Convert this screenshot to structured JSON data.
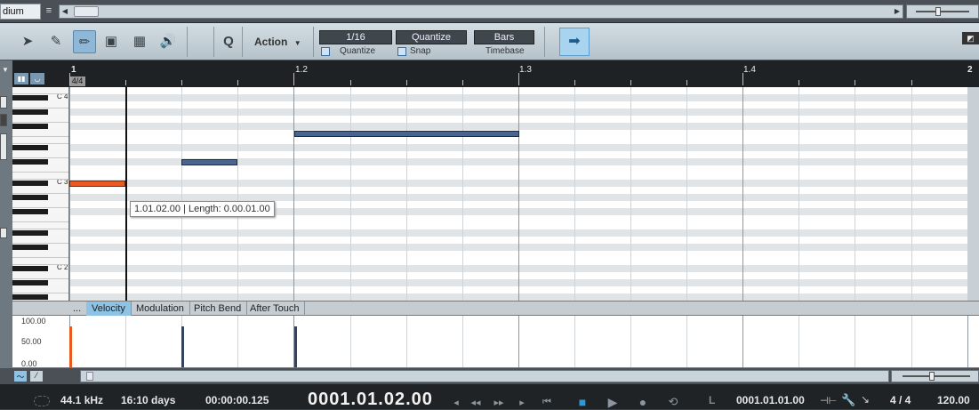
{
  "topbar": {
    "zoom_label": "dium",
    "menu_icon": "menu-icon"
  },
  "toolbar": {
    "tools": [
      "arrow-tool-icon",
      "eraser-tool-icon",
      "pencil-tool-icon",
      "paint-tool-icon",
      "range-tool-icon",
      "listen-tool-icon"
    ],
    "q_label": "Q",
    "action_label": "Action",
    "quantize_value": "1/16",
    "quantize_label": "Quantize",
    "quantize_button": "Quantize",
    "snap_label": "Snap",
    "timebase_value": "Bars",
    "timebase_label": "Timebase"
  },
  "ruler": {
    "marks": [
      "1",
      "1.2",
      "1.3",
      "1.4",
      "2"
    ],
    "time_signature": "4/4"
  },
  "piano": {
    "labels": [
      "C 4",
      "C 3",
      "C 2"
    ]
  },
  "tooltip": "1.01.02.00 | Length: 0.00.01.00",
  "lane_tabs": [
    "...",
    "Velocity",
    "Modulation",
    "Pitch Bend",
    "After Touch"
  ],
  "lane_active_tab": "Velocity",
  "lane_scale": [
    "100.00",
    "50.00",
    "0.00"
  ],
  "notes": [
    {
      "start_step": 0,
      "length_steps": 4,
      "pitch_row": 13,
      "color": "#e85a20",
      "selected": true
    },
    {
      "start_step": 8,
      "length_steps": 4,
      "pitch_row": 10,
      "color": "#4a6490",
      "selected": false
    },
    {
      "start_step": 16,
      "length_steps": 16,
      "pitch_row": 6,
      "color": "#4a6490",
      "selected": false
    }
  ],
  "velocities": [
    {
      "step": 0,
      "value": 0.95,
      "color": "#e85a20"
    },
    {
      "step": 8,
      "value": 0.95,
      "color": "#34445e"
    },
    {
      "step": 16,
      "value": 0.95,
      "color": "#34445e"
    }
  ],
  "transport": {
    "sample_rate": "44.1 kHz",
    "duration": "16:10 days",
    "time": "00:00:00.125",
    "position": "0001.01.02.00",
    "loop_label": "L",
    "loop_start": "0001.01.01.00",
    "time_signature": "4 / 4",
    "tempo": "120.00"
  }
}
